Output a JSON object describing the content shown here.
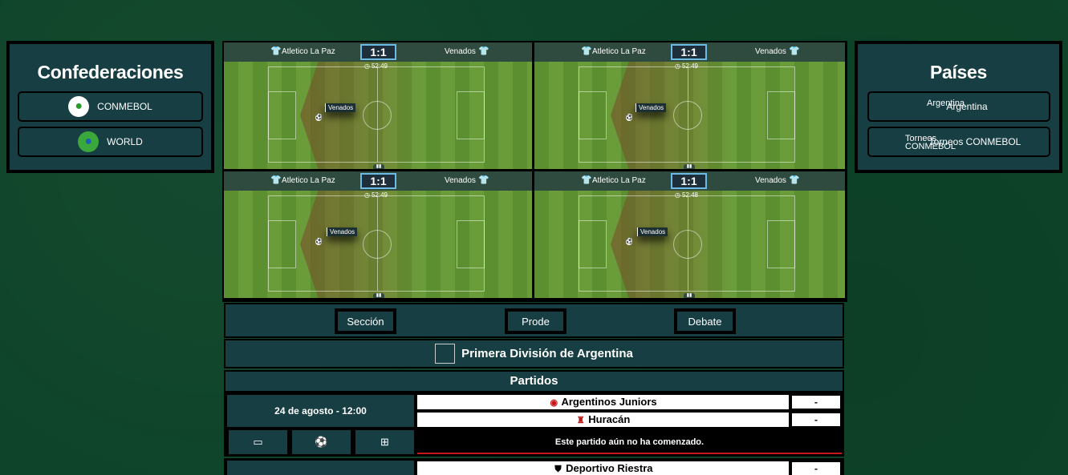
{
  "confederaciones": {
    "title": "Confederaciones",
    "items": [
      {
        "label": "CONMEBOL",
        "icon": "south-america-globe-icon"
      },
      {
        "label": "WORLD",
        "icon": "world-globe-icon"
      }
    ]
  },
  "paises": {
    "title": "Países",
    "items": [
      {
        "label": "Argentina",
        "overlay": "Argentina"
      },
      {
        "label": "Torneos CONMEBOL",
        "overlay": "Torneos CONMEBOL"
      }
    ]
  },
  "live_matches": [
    {
      "home": "Atletico La Paz",
      "away": "Venados",
      "score": "1:1",
      "time": "52:49",
      "possession": "Venados"
    },
    {
      "home": "Atletico La Paz",
      "away": "Venados",
      "score": "1:1",
      "time": "52:49",
      "possession": "Venados"
    },
    {
      "home": "Atletico La Paz",
      "away": "Venados",
      "score": "1:1",
      "time": "52:49",
      "possession": "Venados"
    },
    {
      "home": "Atletico La Paz",
      "away": "Venados",
      "score": "1:1",
      "time": "52:48",
      "possession": "Venados"
    }
  ],
  "tabs": {
    "seccion": "Sección",
    "prode": "Prode",
    "debate": "Debate"
  },
  "league": {
    "name": "Primera División de Argentina"
  },
  "partidos": {
    "title": "Partidos",
    "matches": [
      {
        "date": "24 de agosto - 12:00",
        "home": "Argentinos Juniors",
        "away": "Huracán",
        "home_score": "-",
        "away_score": "-",
        "status": "Este partido aún no ha comenzado."
      },
      {
        "date": "",
        "home": "Deportivo Riestra",
        "home_score": "-"
      }
    ]
  },
  "colors": {
    "background": "#0e4429",
    "panel": "#173e43",
    "score_border": "#6dbbe5",
    "status_underline": "#c41818"
  }
}
